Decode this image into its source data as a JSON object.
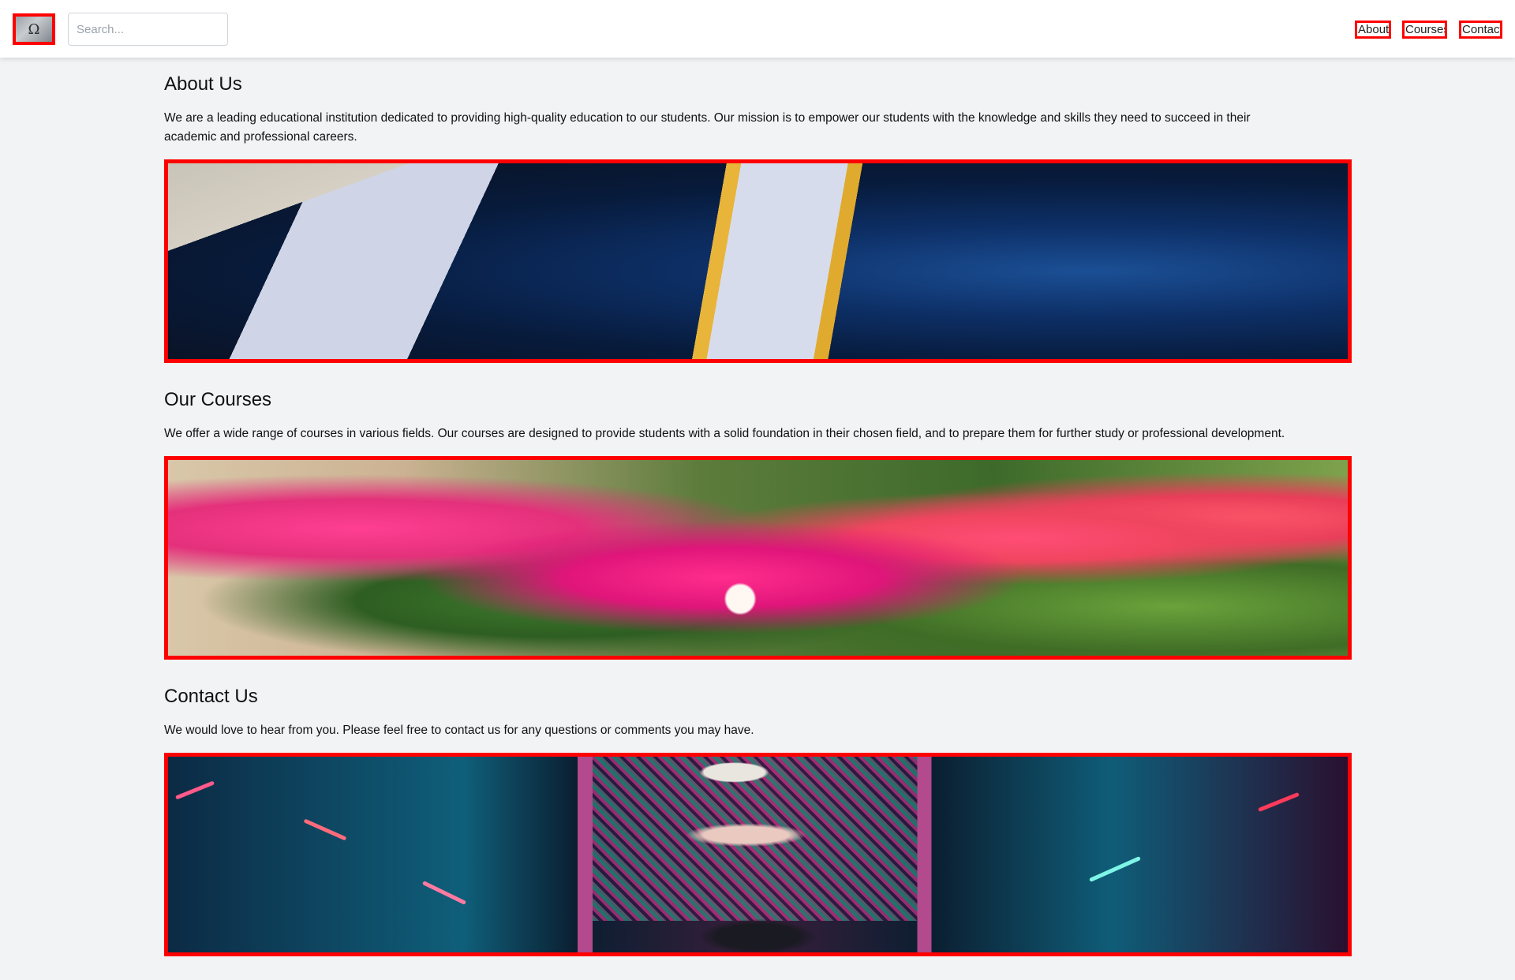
{
  "nav": {
    "logo_alt": "Logo",
    "search_placeholder": "Search...",
    "links": [
      {
        "label": "About"
      },
      {
        "label": "Courses"
      },
      {
        "label": "Contact"
      }
    ]
  },
  "sections": [
    {
      "title": "About Us",
      "text": "We are a leading educational institution dedicated to providing high-quality education to our students. Our mission is to empower our students with the knowledge and skills they need to succeed in their academic and professional careers.",
      "image_subject": "graduation gown with gold stole"
    },
    {
      "title": "Our Courses",
      "text": "We offer a wide range of courses in various fields. Our courses are designed to provide students with a solid foundation in their chosen field, and to prepare them for further study or professional development.",
      "image_subject": "pink bougainvillea flowers"
    },
    {
      "title": "Contact Us",
      "text": "We would love to hear from you. Please feel free to contact us for any questions or comments you may have.",
      "image_subject": "concert stage with neon lights"
    }
  ],
  "colors": {
    "page_background": "#f2f3f5",
    "highlight_border": "#ff0000",
    "header_background": "#ffffff"
  }
}
